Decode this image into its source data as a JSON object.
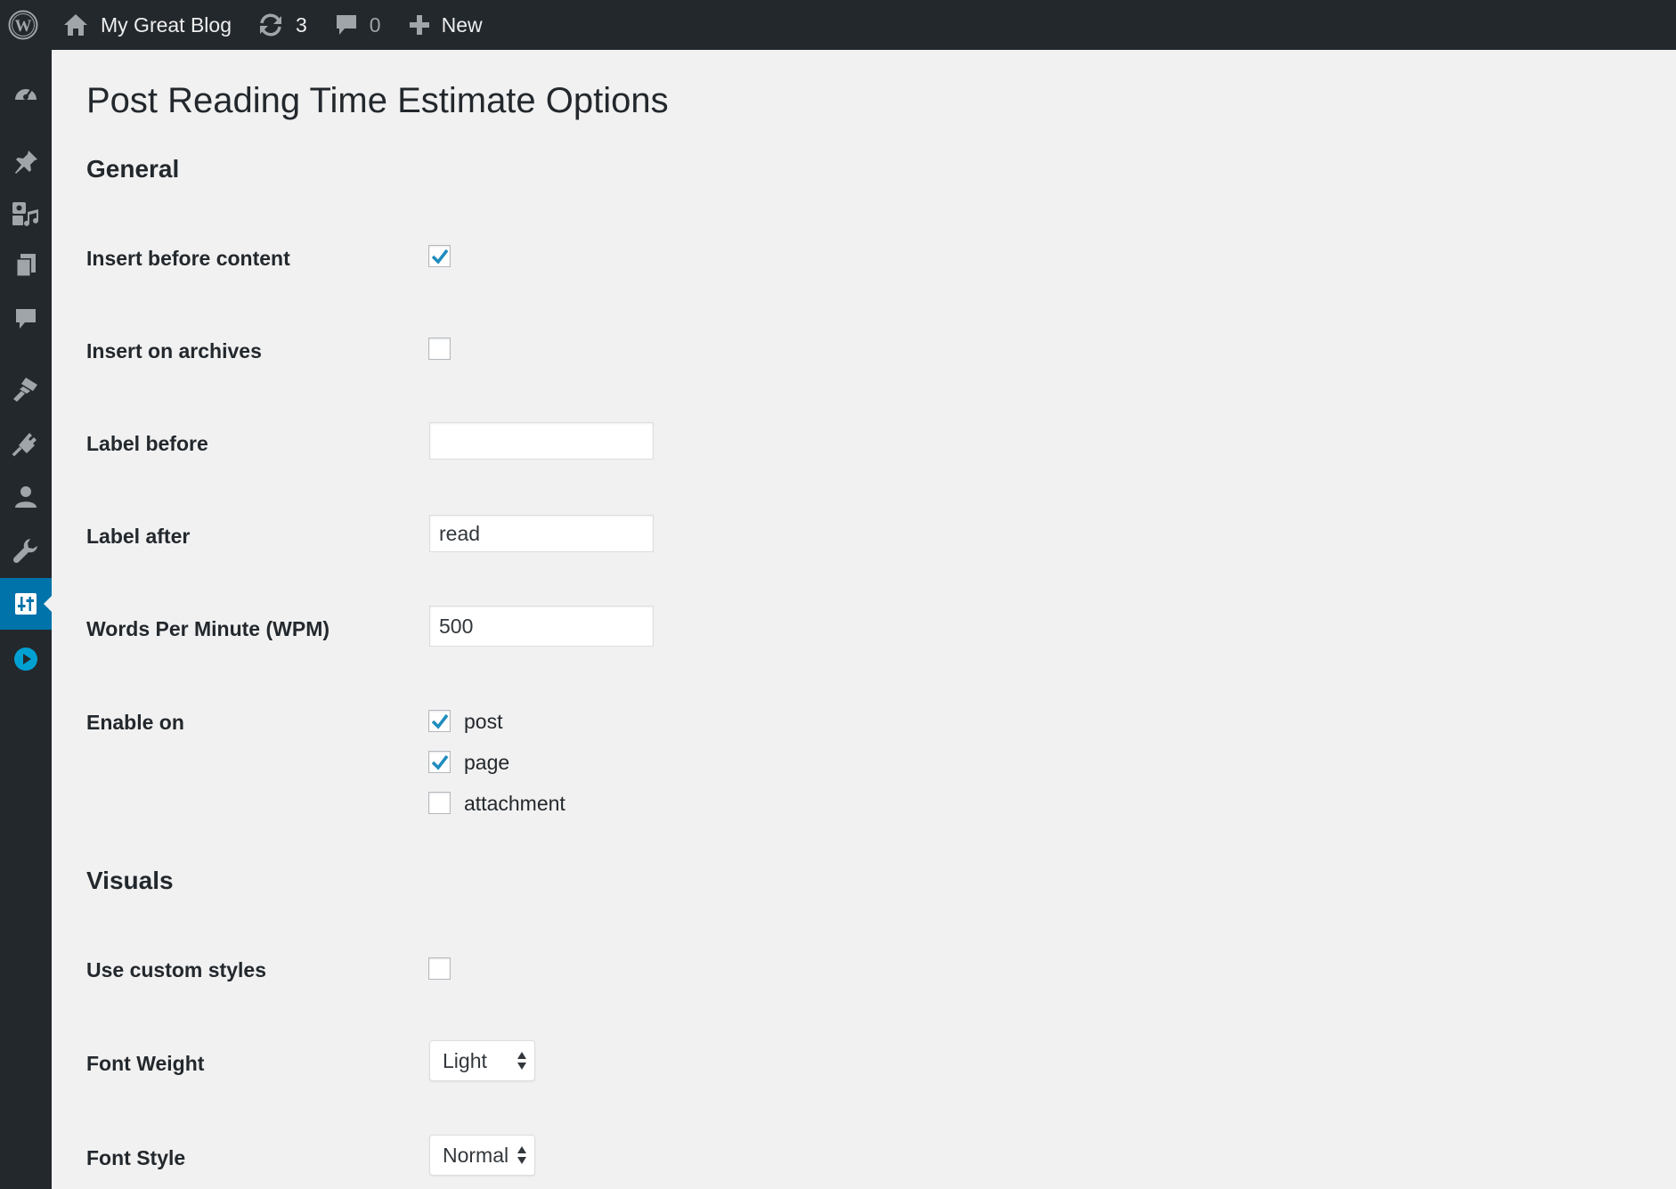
{
  "admin_bar": {
    "site_name": "My Great Blog",
    "updates_count": "3",
    "comments_count": "0",
    "new_label": "New",
    "icons": [
      "wordpress-logo-icon",
      "home-icon",
      "updates-icon",
      "comments-icon",
      "plus-icon"
    ]
  },
  "sidebar": {
    "items": [
      {
        "name": "dashboard",
        "icon": "dashboard-icon"
      },
      {
        "name": "posts",
        "icon": "pin-icon"
      },
      {
        "name": "media",
        "icon": "media-icon"
      },
      {
        "name": "pages",
        "icon": "pages-icon"
      },
      {
        "name": "comments",
        "icon": "comment-icon"
      },
      {
        "name": "appearance",
        "icon": "brush-icon"
      },
      {
        "name": "plugins",
        "icon": "plugin-icon"
      },
      {
        "name": "users",
        "icon": "user-icon"
      },
      {
        "name": "tools",
        "icon": "wrench-icon"
      },
      {
        "name": "settings",
        "icon": "settings-icon",
        "active": true
      },
      {
        "name": "video",
        "icon": "play-icon"
      }
    ],
    "colors": {
      "background": "#23282d",
      "active": "#0073aa",
      "icon": "#a0a5aa",
      "play": "#00a0d2"
    }
  },
  "page": {
    "title": "Post Reading Time Estimate Options",
    "sections": {
      "general": {
        "title": "General",
        "insert_before_content": {
          "label": "Insert before content",
          "checked": true
        },
        "insert_on_archives": {
          "label": "Insert on archives",
          "checked": false
        },
        "label_before": {
          "label": "Label before",
          "value": ""
        },
        "label_after": {
          "label": "Label after",
          "value": "read"
        },
        "wpm": {
          "label": "Words Per Minute (WPM)",
          "value": "500"
        },
        "enable_on": {
          "label": "Enable on",
          "options": [
            {
              "label": "post",
              "checked": true
            },
            {
              "label": "page",
              "checked": true
            },
            {
              "label": "attachment",
              "checked": false
            }
          ]
        }
      },
      "visuals": {
        "title": "Visuals",
        "use_custom_styles": {
          "label": "Use custom styles",
          "checked": false
        },
        "font_weight": {
          "label": "Font Weight",
          "selected": "Light"
        },
        "font_style": {
          "label": "Font Style",
          "selected": "Normal"
        }
      }
    }
  },
  "colors": {
    "accent": "#1e8cbe",
    "page_bg": "#f1f1f1",
    "text": "#23282d"
  }
}
